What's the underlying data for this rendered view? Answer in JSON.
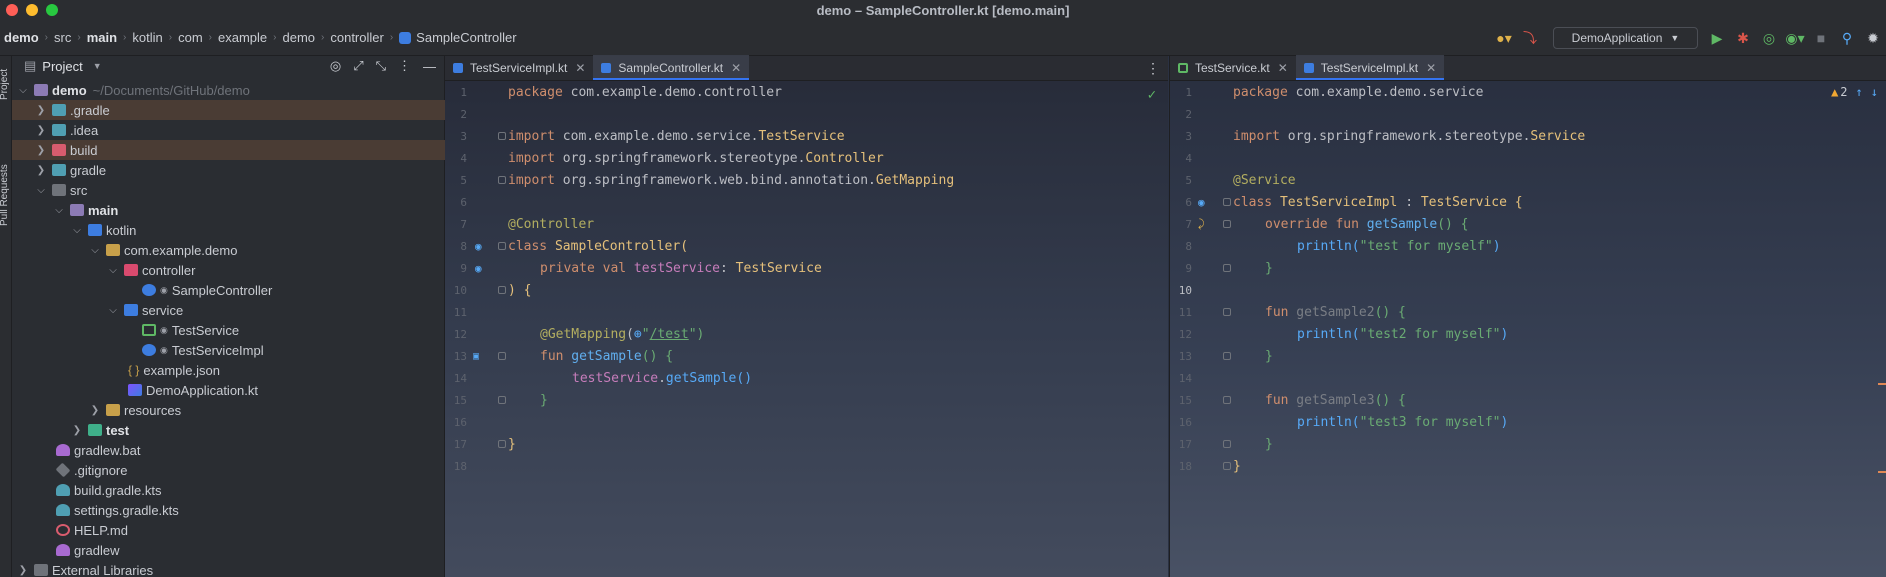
{
  "window": {
    "title": "demo – SampleController.kt [demo.main]"
  },
  "navbar": {
    "breadcrumbs": [
      "demo",
      "src",
      "main",
      "kotlin",
      "com",
      "example",
      "demo",
      "controller",
      "SampleController"
    ],
    "run_config": "DemoApplication"
  },
  "tool_strip": {
    "project_label": "Project",
    "pull_requests_label": "Pull Requests"
  },
  "project_panel": {
    "title": "Project",
    "tree": [
      {
        "label": "demo",
        "hint": "~/Documents/GitHub/demo",
        "bold": true
      },
      {
        "label": ".gradle"
      },
      {
        "label": ".idea"
      },
      {
        "label": "build"
      },
      {
        "label": "gradle"
      },
      {
        "label": "src"
      },
      {
        "label": "main",
        "bold": true
      },
      {
        "label": "kotlin"
      },
      {
        "label": "com.example.demo"
      },
      {
        "label": "controller"
      },
      {
        "label": "SampleController"
      },
      {
        "label": "service"
      },
      {
        "label": "TestService"
      },
      {
        "label": "TestServiceImpl"
      },
      {
        "label": "example.json"
      },
      {
        "label": "DemoApplication.kt"
      },
      {
        "label": "resources"
      },
      {
        "label": "test",
        "bold": true
      },
      {
        "label": "gradlew.bat"
      },
      {
        "label": ".gitignore"
      },
      {
        "label": "build.gradle.kts"
      },
      {
        "label": "settings.gradle.kts"
      },
      {
        "label": "HELP.md"
      },
      {
        "label": "gradlew"
      },
      {
        "label": "External Libraries"
      }
    ]
  },
  "editor_left": {
    "tabs": [
      {
        "label": "TestServiceImpl.kt",
        "active": false
      },
      {
        "label": "SampleController.kt",
        "active": true
      }
    ],
    "line_numbers": [
      "1",
      "2",
      "3",
      "4",
      "5",
      "6",
      "7",
      "8",
      "9",
      "10",
      "11",
      "12",
      "13",
      "14",
      "15",
      "16",
      "17",
      "18"
    ],
    "code": {
      "l1": [
        "package",
        " com.example.demo.controller"
      ],
      "l3": [
        "import",
        " com.example.demo.service.",
        "TestService"
      ],
      "l4": [
        "import",
        " org.springframework.stereotype.",
        "Controller"
      ],
      "l5": [
        "import",
        " org.springframework.web.bind.annotation.",
        "GetMapping"
      ],
      "l7": [
        "@Controller"
      ],
      "l8": [
        "class",
        " SampleController("
      ],
      "l9": [
        "private val",
        " testService",
        ": ",
        "TestService"
      ],
      "l10": [
        ") {"
      ],
      "l12": [
        "@GetMapping",
        "(",
        "⊕",
        "\"",
        "/test",
        "\")"
      ],
      "l13": [
        "fun",
        " getSample",
        "() {"
      ],
      "l14": [
        "testService",
        ".",
        "getSample",
        "()"
      ],
      "l15": [
        "}"
      ],
      "l17": [
        "}"
      ]
    }
  },
  "editor_right": {
    "tabs": [
      {
        "label": "TestService.kt",
        "active": false
      },
      {
        "label": "TestServiceImpl.kt",
        "active": true
      }
    ],
    "warning_count": "2",
    "line_numbers": [
      "1",
      "2",
      "3",
      "4",
      "5",
      "6",
      "7",
      "8",
      "9",
      "10",
      "11",
      "12",
      "13",
      "14",
      "15",
      "16",
      "17",
      "18"
    ],
    "code": {
      "l1": [
        "package",
        " com.example.demo.service"
      ],
      "l3": [
        "import",
        " org.springframework.stereotype.",
        "Service"
      ],
      "l5": [
        "@Service"
      ],
      "l6": [
        "class",
        " TestServiceImpl",
        " : ",
        "TestService",
        " {"
      ],
      "l7": [
        "override fun",
        " getSample",
        "() {"
      ],
      "l8": [
        "println",
        "(",
        "\"test for myself\"",
        ")"
      ],
      "l9": [
        "}"
      ],
      "l11": [
        "fun",
        " getSample2",
        "() {"
      ],
      "l12": [
        "println",
        "(",
        "\"test2 for myself\"",
        ")"
      ],
      "l13": [
        "}"
      ],
      "l15": [
        "fun",
        " getSample3",
        "() {"
      ],
      "l16": [
        "println",
        "(",
        "\"test3 for myself\"",
        ")"
      ],
      "l17": [
        "}"
      ],
      "l18": [
        "}"
      ]
    }
  },
  "colors": {
    "accent": "#3574f0",
    "keyword": "#cf8e6d",
    "class": "#e5c07b",
    "string": "#6aab73",
    "function": "#57aaf7",
    "property": "#c77dbb"
  }
}
